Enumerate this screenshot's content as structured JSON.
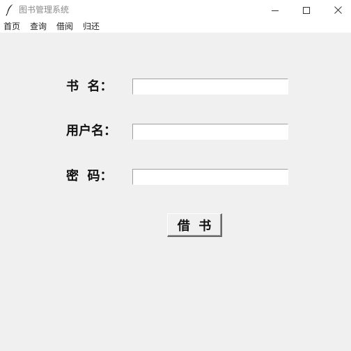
{
  "window": {
    "title": "图书管理系统",
    "controls": {
      "minimize": "minimize-icon",
      "maximize": "maximize-icon",
      "close": "close-icon"
    }
  },
  "menu": {
    "items": [
      {
        "label": "首页"
      },
      {
        "label": "查询"
      },
      {
        "label": "借阅"
      },
      {
        "label": "归还"
      }
    ]
  },
  "form": {
    "book_label": "书  名：",
    "book_value": "",
    "user_label": "用户名：",
    "user_value": "",
    "password_label": "密  码：",
    "password_value": "",
    "submit_label": "借  书"
  },
  "colors": {
    "background": "#f0f0f0",
    "titlebar": "#ffffff",
    "title_text": "#8a8a8a"
  }
}
